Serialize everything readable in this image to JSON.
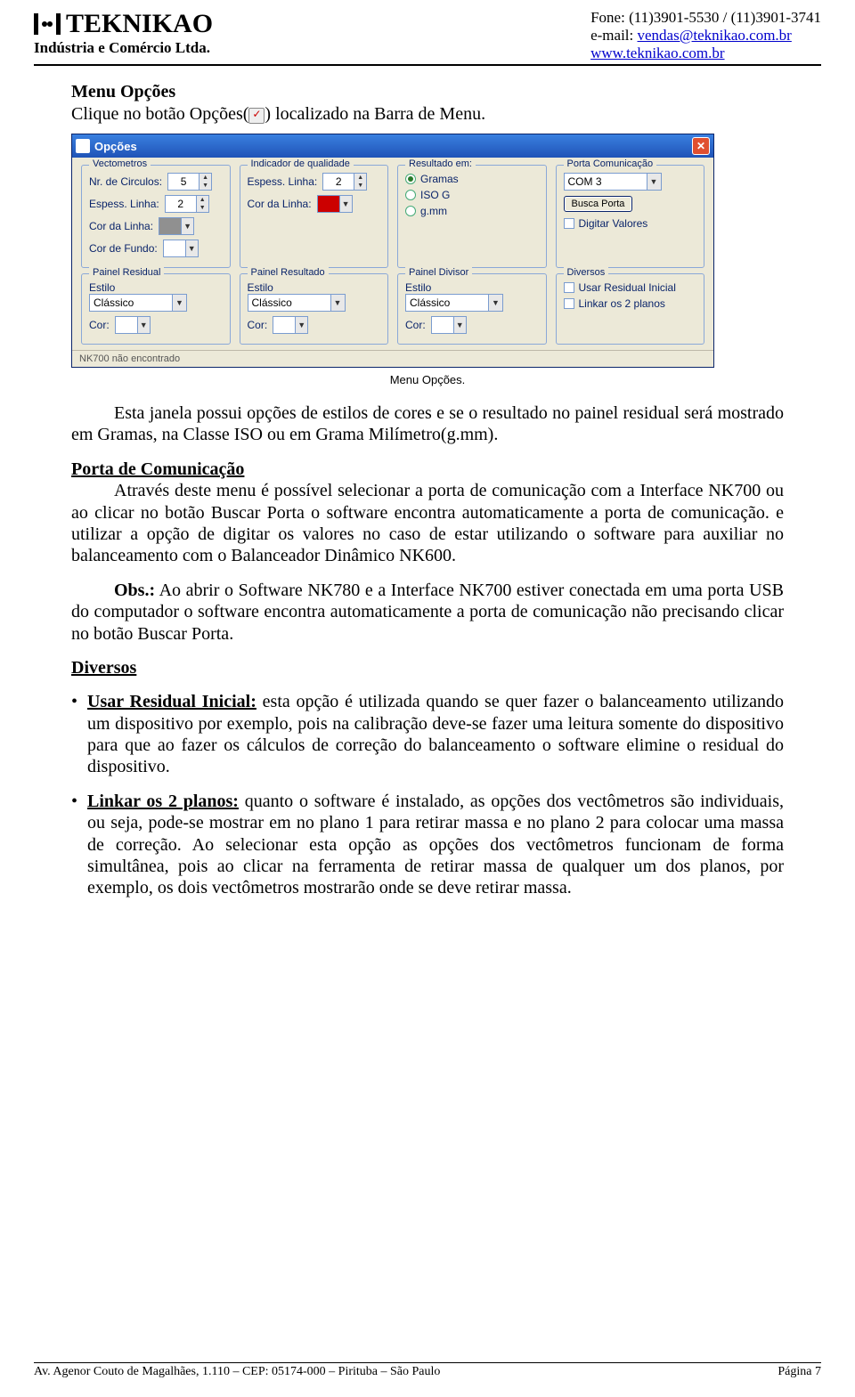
{
  "header": {
    "company_name": "TEKNIKAO",
    "company_sub": "Indústria e Comércio Ltda.",
    "phone_line": "Fone: (11)3901-5530 / (11)3901-3741",
    "email_prefix": "e-mail: ",
    "email_link": "vendas@teknikao.com.br",
    "site_link": "www.teknikao.com.br"
  },
  "body": {
    "section_title": "Menu Opções",
    "intro_before": "Clique no botão Opções(",
    "intro_after": ")  localizado na Barra de Menu.",
    "caption": "Menu Opções.",
    "p1": "Esta janela possui opções de estilos de cores e se o resultado no painel residual será mostrado em Gramas, na Classe ISO ou em Grama Milímetro(g.mm).",
    "h_porta": "Porta de Comunicação",
    "p_porta": "Através deste menu é possível selecionar a porta de comunicação com a Interface NK700 ou ao clicar no botão Buscar Porta o software encontra automaticamente a porta de comunicação. e utilizar a opção de digitar os valores no caso de estar utilizando o software para auxiliar no balanceamento com o Balanceador Dinâmico NK600.",
    "p_obs_lead": "Obs.:",
    "p_obs": " Ao abrir o Software NK780 e a Interface NK700 estiver conectada em uma porta USB do computador o software encontra automaticamente a porta de comunicação não precisando clicar no botão Buscar Porta.",
    "h_diversos": "Diversos",
    "li1_lead": "Usar Residual Inicial:",
    "li1": " esta opção é utilizada quando se quer fazer o balanceamento utilizando um dispositivo por exemplo, pois na calibração deve-se fazer uma leitura somente do dispositivo para que ao fazer os cálculos de correção do balanceamento o software elimine o residual do dispositivo.",
    "li2_lead": "Linkar os 2 planos:",
    "li2": " quanto o software é instalado, as opções dos vectômetros são individuais, ou seja, pode-se mostrar em no plano 1 para retirar massa e no plano 2 para colocar uma massa de correção. Ao selecionar esta opção as opções dos vectômetros funcionam de forma simultânea, pois ao clicar na ferramenta de retirar massa de qualquer um dos planos, por exemplo, os dois vectômetros mostrarão onde se deve retirar massa."
  },
  "dialog": {
    "title": "Opções",
    "vect": {
      "legend": "Vectometros",
      "nr_circ_lbl": "Nr. de Circulos:",
      "nr_circ_val": "5",
      "esp_linha_lbl": "Espess. Linha:",
      "esp_linha_val": "2",
      "cor_linha_lbl": "Cor da Linha:",
      "cor_fundo_lbl": "Cor de Fundo:"
    },
    "indic": {
      "legend": "Indicador de qualidade",
      "esp_linha_lbl": "Espess. Linha:",
      "esp_linha_val": "2",
      "cor_linha_lbl": "Cor da Linha:"
    },
    "resultado": {
      "legend": "Resultado em:",
      "opt1": "Gramas",
      "opt2": "ISO G",
      "opt3": "g.mm"
    },
    "porta": {
      "legend": "Porta Comunicação",
      "combo_val": "COM 3",
      "btn": "Busca Porta",
      "check": "Digitar Valores"
    },
    "painel_res": {
      "legend": "Painel Residual",
      "estilo_lbl": "Estilo",
      "combo_val": "Clássico",
      "cor_lbl": "Cor:"
    },
    "painel_resultado": {
      "legend": "Painel Resultado",
      "estilo_lbl": "Estilo",
      "combo_val": "Clássico",
      "cor_lbl": "Cor:"
    },
    "painel_div": {
      "legend": "Painel Divisor",
      "estilo_lbl": "Estilo",
      "combo_val": "Clássico",
      "cor_lbl": "Cor:"
    },
    "diversos": {
      "legend": "Diversos",
      "check1": "Usar Residual Inicial",
      "check2": "Linkar os 2 planos"
    },
    "status": "NK700 não encontrado"
  },
  "footer": {
    "left": "Av. Agenor Couto de Magalhães, 1.110 – CEP: 05174-000 – Pirituba – São Paulo",
    "right": "Página 7"
  },
  "colors": {
    "indic_red": "#cc0000",
    "vect_gray": "#909090",
    "white": "#ffffff"
  }
}
